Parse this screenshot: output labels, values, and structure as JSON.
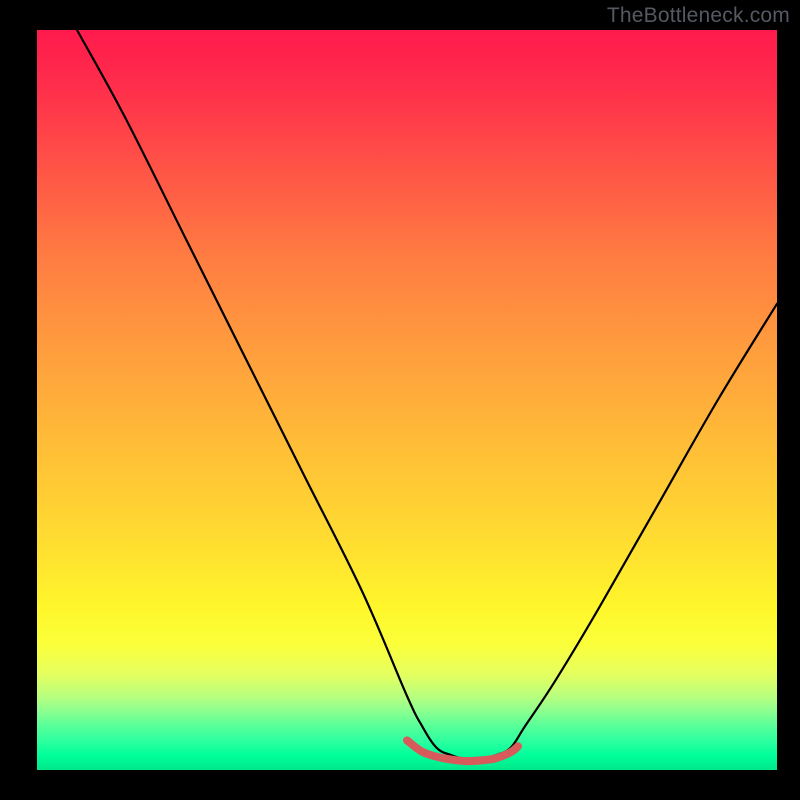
{
  "watermark": "TheBottleneck.com",
  "chart_data": {
    "type": "line",
    "title": "",
    "xlabel": "",
    "ylabel": "",
    "xlim": [
      0,
      100
    ],
    "ylim": [
      0,
      100
    ],
    "grid": false,
    "legend": false,
    "note": "x/y are in percent of the plot area (0–100). y=0 is the bottom (minimum of the V-curve), y=100 is the top.",
    "series": [
      {
        "name": "bottleneck-curve",
        "color": "#000000",
        "x": [
          5.4,
          12,
          20,
          28,
          36,
          44,
          50,
          52,
          54,
          56,
          58,
          60,
          62,
          64,
          66,
          70,
          76,
          84,
          92,
          100
        ],
        "y": [
          100,
          88,
          72,
          56,
          40,
          24,
          10,
          6,
          3,
          2,
          1.4,
          1.4,
          2,
          3,
          6,
          12,
          22,
          36,
          50,
          63
        ]
      },
      {
        "name": "optimal-band",
        "color": "#d85a5a",
        "x": [
          50,
          52,
          54,
          56,
          58,
          60,
          62,
          64,
          65
        ],
        "y": [
          4,
          2.5,
          1.8,
          1.4,
          1.2,
          1.3,
          1.6,
          2.4,
          3.2
        ]
      }
    ],
    "gradient_stops": [
      {
        "pct": 0,
        "color": "#ff1a4d"
      },
      {
        "pct": 50,
        "color": "#ffb838"
      },
      {
        "pct": 82,
        "color": "#fbff3a"
      },
      {
        "pct": 95,
        "color": "#2fff9f"
      },
      {
        "pct": 100,
        "color": "#00e78a"
      }
    ]
  }
}
